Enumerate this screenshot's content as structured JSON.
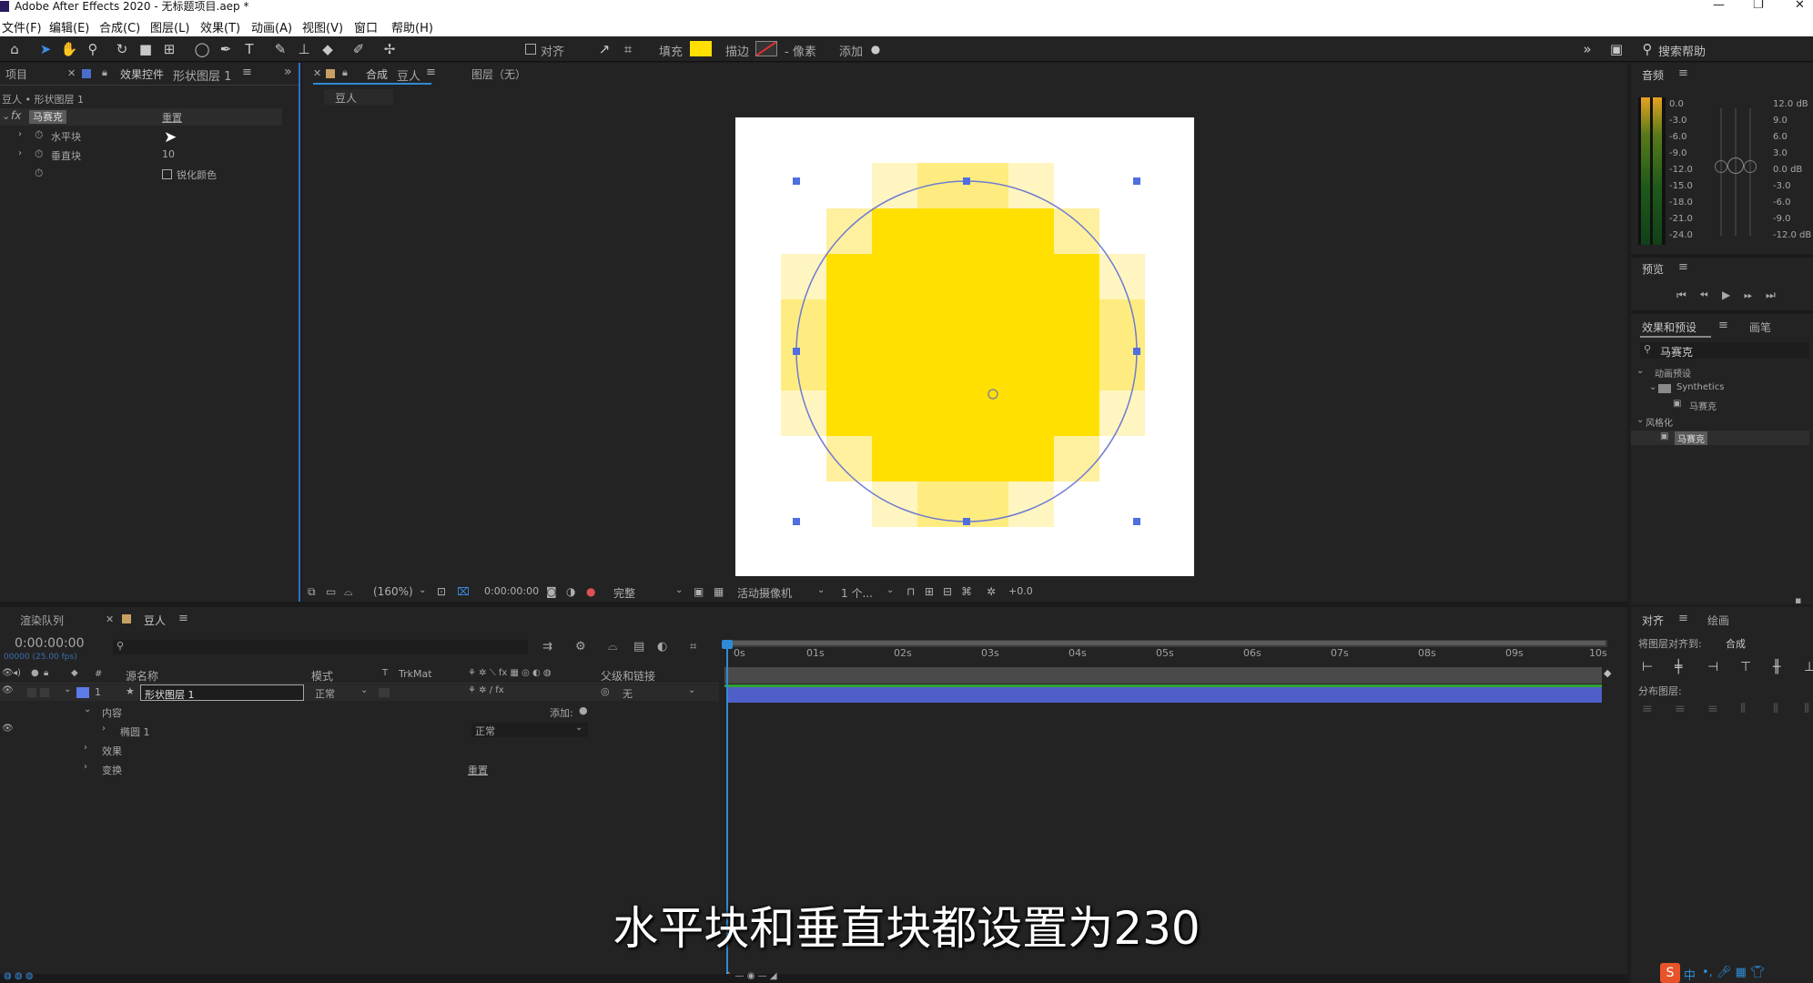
{
  "window": {
    "title": "Adobe After Effects 2020 - 无标题项目.aep *"
  },
  "menu": [
    "文件(F)",
    "编辑(E)",
    "合成(C)",
    "图层(L)",
    "效果(T)",
    "动画(A)",
    "视图(V)",
    "窗口",
    "帮助(H)"
  ],
  "toolbar": {
    "align_label": "对齐",
    "fill_label": "填充",
    "stroke_label": "描边",
    "stroke_unit": "- 像素",
    "add_label": "添加",
    "search_placeholder": "搜索帮助",
    "fill_color": "#ffe000"
  },
  "left_panel": {
    "tab_project": "项目",
    "tab_effects": "效果控件",
    "tab_effects_layer": "形状图层 1",
    "breadcrumb": "豆人 • 形状图层 1",
    "effect_name": "马赛克",
    "reset_label": "重置",
    "props": [
      {
        "label": "水平块",
        "value": ""
      },
      {
        "label": "垂直块",
        "value": "10"
      }
    ],
    "sharp_color_label": "锐化颜色"
  },
  "comp_panel": {
    "tab_label": "合成",
    "comp_name": "豆人",
    "layer_tab": "图层（无）",
    "sub_tab": "豆人"
  },
  "viewer_controls": {
    "zoom": "(160%)",
    "timecode": "0:00:00:00",
    "quality": "完整",
    "camera": "活动摄像机",
    "views": "1 个...",
    "exposure": "+0.0"
  },
  "audio": {
    "title": "音频",
    "left_scale": [
      "0.0",
      "-3.0",
      "-6.0",
      "-9.0",
      "-12.0",
      "-15.0",
      "-18.0",
      "-21.0",
      "-24.0"
    ],
    "right_scale": [
      "12.0 dB",
      "9.0",
      "6.0",
      "3.0",
      "0.0 dB",
      "-3.0",
      "-6.0",
      "-9.0",
      "-12.0 dB"
    ]
  },
  "preview": {
    "title": "预览"
  },
  "effects_presets": {
    "title": "效果和预设",
    "brush_tab": "画笔",
    "search_value": "马赛克",
    "tree": [
      {
        "label": "动画预设",
        "level": 0
      },
      {
        "label": "Synthetics",
        "level": 1
      },
      {
        "label": "马赛克",
        "level": 2
      },
      {
        "label": "风格化",
        "level": 0
      },
      {
        "label": "马赛克",
        "level": 1,
        "selected": true
      }
    ]
  },
  "align_panel": {
    "title": "对齐",
    "paint_tab": "绘画",
    "align_to_label": "将图层对齐到:",
    "align_to_value": "合成",
    "distribute_label": "分布图层:"
  },
  "timeline": {
    "render_queue_tab": "渲染队列",
    "comp_tab": "豆人",
    "timecode": "0:00:00:00",
    "fps": "00000 (25.00 fps)",
    "col_source": "源名称",
    "col_mode": "模式",
    "col_t": "T",
    "col_trkmat": "TrkMat",
    "col_parent": "父级和链接",
    "layer_num": "1",
    "layer_name": "形状图层 1",
    "layer_mode": "正常",
    "layer_parent": "无",
    "contents_label": "内容",
    "add_label": "添加:",
    "ellipse_label": "椭圆 1",
    "ellipse_mode": "正常",
    "effects_label": "效果",
    "transform_label": "变换",
    "transform_reset": "重置",
    "ruler": [
      "0s",
      "01s",
      "02s",
      "03s",
      "04s",
      "05s",
      "06s",
      "07s",
      "08s",
      "09s",
      "10s"
    ]
  },
  "subtitle": "水平块和垂直块都设置为230",
  "taskbar_ime": "中"
}
